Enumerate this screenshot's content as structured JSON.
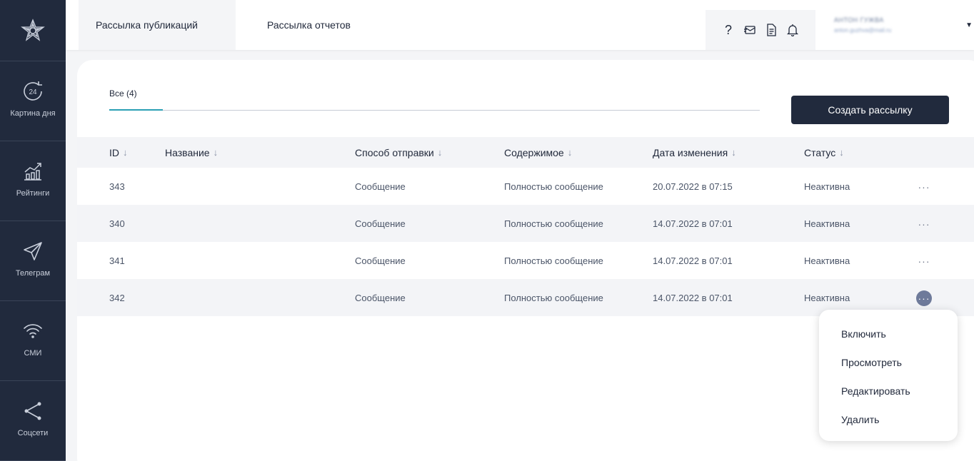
{
  "sidebar": {
    "logo": "star-logo-icon",
    "items": [
      {
        "label": "Картина дня",
        "icon": "clock-24-icon",
        "badge": "24"
      },
      {
        "label": "Рейтинги",
        "icon": "chart-up-icon"
      },
      {
        "label": "Телеграм",
        "icon": "send-icon"
      },
      {
        "label": "СМИ",
        "icon": "wifi-icon"
      },
      {
        "label": "Соцсети",
        "icon": "share-icon"
      }
    ]
  },
  "topbar": {
    "tabs": [
      {
        "label": "Рассылка публикаций",
        "active": true
      },
      {
        "label": "Рассылка отчетов",
        "active": false
      }
    ],
    "icons": [
      "help-icon",
      "mail-icon",
      "document-icon",
      "bell-icon"
    ],
    "help_glyph": "?",
    "user": {
      "name": "АНТОН ГУЖВА",
      "email": "anton.guzhva@mail.ru"
    }
  },
  "content": {
    "filter_tab": "Все (4)",
    "create_button": "Создать рассылку"
  },
  "table": {
    "columns": [
      {
        "label": "ID"
      },
      {
        "label": "Название"
      },
      {
        "label": "Способ отправки"
      },
      {
        "label": "Содержимое"
      },
      {
        "label": "Дата изменения"
      },
      {
        "label": "Статус"
      }
    ],
    "sort_arrow": "↓",
    "rows": [
      {
        "id": "343",
        "name": "",
        "method": "Сообщение",
        "content": "Полностью сообщение",
        "date": "20.07.2022 в 07:15",
        "status": "Неактивна",
        "more": "···"
      },
      {
        "id": "340",
        "name": "",
        "method": "Сообщение",
        "content": "Полностью сообщение",
        "date": "14.07.2022 в 07:01",
        "status": "Неактивна",
        "more": "···"
      },
      {
        "id": "341",
        "name": "",
        "method": "Сообщение",
        "content": "Полностью сообщение",
        "date": "14.07.2022 в 07:01",
        "status": "Неактивна",
        "more": "···"
      },
      {
        "id": "342",
        "name": "",
        "method": "Сообщение",
        "content": "Полностью сообщение",
        "date": "14.07.2022 в 07:01",
        "status": "Неактивна",
        "more": "···"
      }
    ]
  },
  "dropdown": {
    "items": [
      "Включить",
      "Просмотреть",
      "Редактировать",
      "Удалить"
    ]
  },
  "colors": {
    "sidebar_bg": "#212a3d",
    "accent": "#2a9fb4",
    "button_bg": "#212a3d",
    "active_more": "#6e7a9a"
  }
}
